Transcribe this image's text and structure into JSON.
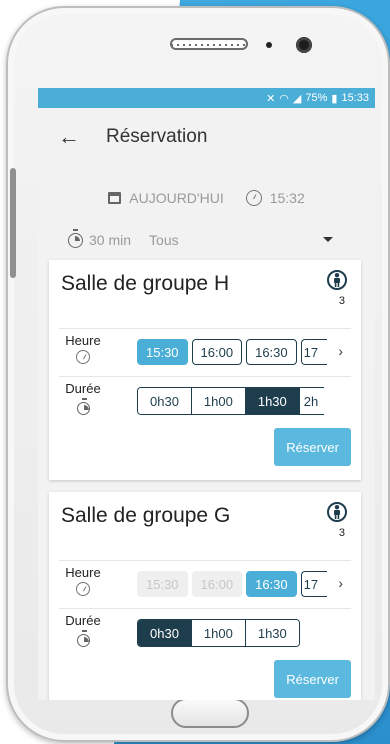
{
  "status_bar": {
    "battery": "75%",
    "time": "15:33"
  },
  "app_bar": {
    "title": "Réservation"
  },
  "filters": {
    "date_label": "AUJOURD'HUI",
    "time_value": "15:32",
    "duration_value": "30 min",
    "type_value": "Tous"
  },
  "rooms": [
    {
      "name": "Salle de groupe H",
      "capacity": "3",
      "heure_label": "Heure",
      "duree_label": "Durée",
      "times": [
        "15:30",
        "16:00",
        "16:30",
        "17"
      ],
      "durations": [
        "0h30",
        "1h00",
        "1h30",
        "2h"
      ],
      "reserve_label": "Réserver"
    },
    {
      "name": "Salle de groupe G",
      "capacity": "3",
      "heure_label": "Heure",
      "duree_label": "Durée",
      "times": [
        "15:30",
        "16:00",
        "16:30",
        "17"
      ],
      "durations": [
        "0h30",
        "1h00",
        "1h30"
      ],
      "reserve_label": "Réserver"
    }
  ],
  "colors": {
    "accent": "#4aaed7",
    "dark": "#1f3e4d"
  },
  "icons": [
    "back-arrow-icon",
    "calendar-icon",
    "clock-icon",
    "timer-icon",
    "dropdown-arrow-icon",
    "person-icon",
    "chevron-right-icon"
  ]
}
